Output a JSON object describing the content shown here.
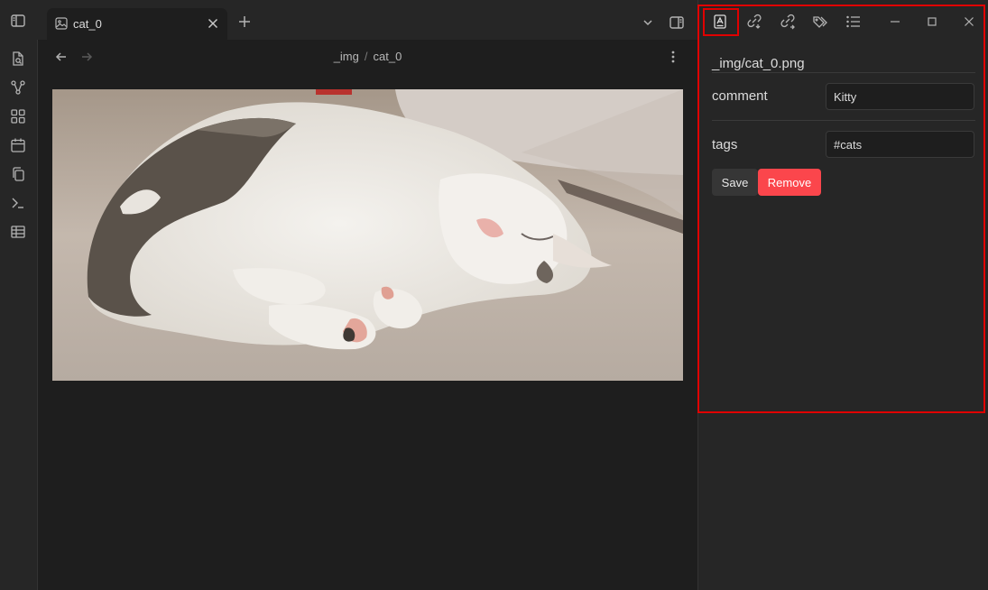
{
  "tab": {
    "title": "cat_0",
    "icon": "image-icon"
  },
  "breadcrumb": {
    "folder": "_img",
    "separator": "/",
    "file": "cat_0"
  },
  "panel": {
    "file_path": "_img/cat_0.png",
    "fields": [
      {
        "label": "comment",
        "value": "Kitty"
      },
      {
        "label": "tags",
        "value": "#cats"
      }
    ],
    "save_label": "Save",
    "remove_label": "Remove"
  },
  "colors": {
    "accent_red": "#fb464c",
    "highlight_red": "#e00000",
    "background": "#1e1e1e",
    "sidebar": "#262626"
  }
}
